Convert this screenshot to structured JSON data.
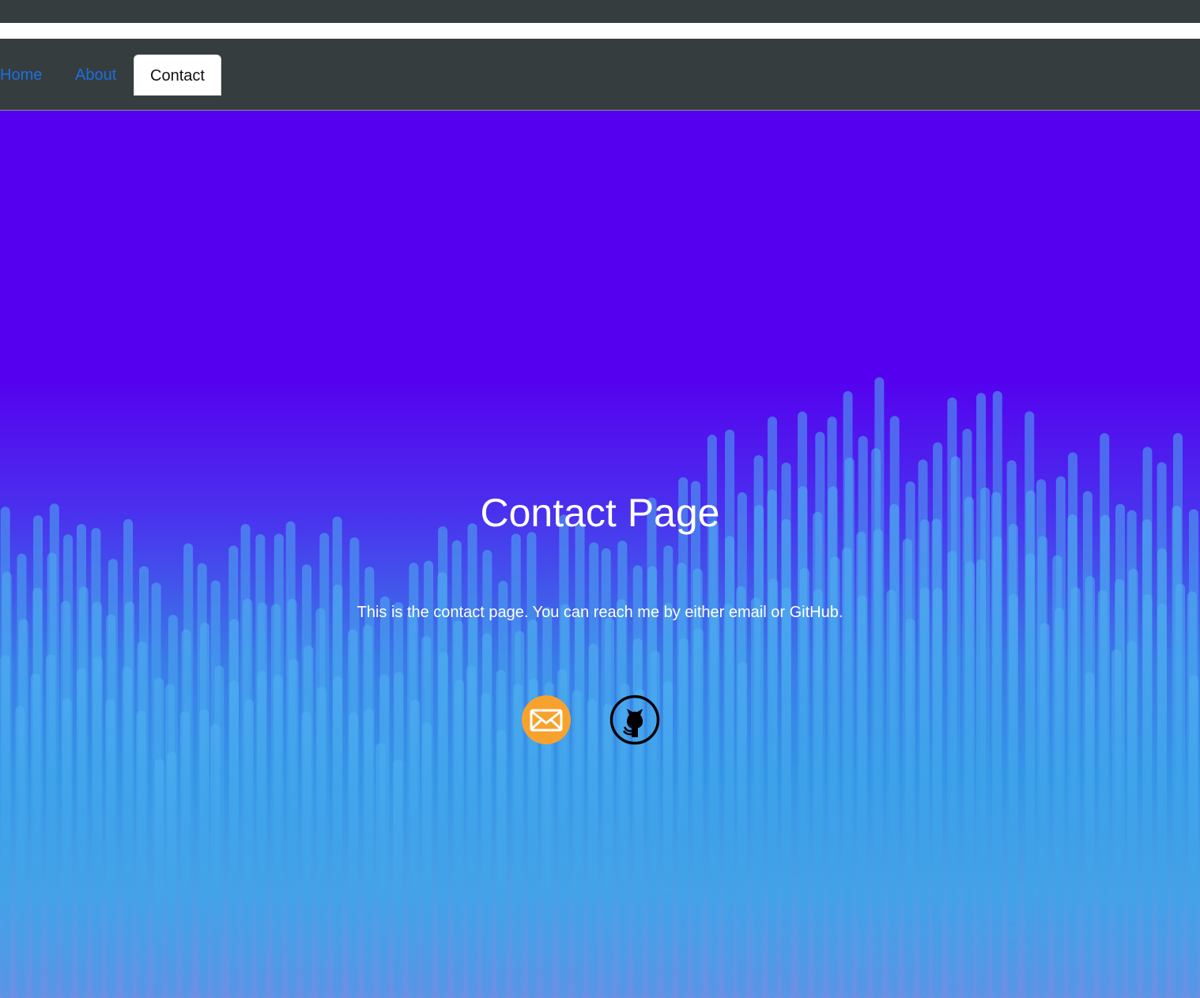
{
  "nav": {
    "items": [
      {
        "label": "Home",
        "active": false
      },
      {
        "label": "About",
        "active": false
      },
      {
        "label": "Contact",
        "active": true
      }
    ]
  },
  "hero": {
    "title": "Contact Page",
    "description": "This is the contact page. You can reach me by either email or GitHub."
  },
  "contacts": [
    {
      "icon": "email-icon",
      "color": "#f7a22e"
    },
    {
      "icon": "github-icon",
      "color": "#000000"
    }
  ],
  "colors": {
    "navbar": "#363d3f",
    "link": "#1a6fe0",
    "hero_top": "#5500ee",
    "hero_bottom": "#6f8ee4"
  }
}
